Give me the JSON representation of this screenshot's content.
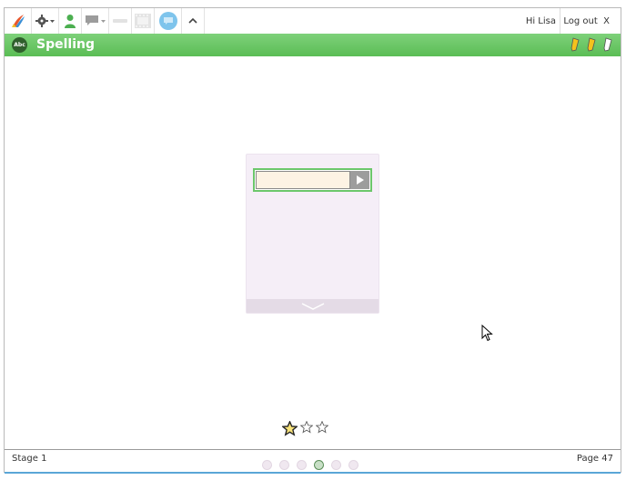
{
  "toolbar": {
    "greeting": "Hi Lisa",
    "logout_label": "Log out",
    "close_label": "X"
  },
  "titlebar": {
    "icon_text": "Abc",
    "title": "Spelling"
  },
  "panel": {
    "input_value": ""
  },
  "stars": {
    "filled": 1,
    "total": 3
  },
  "footer": {
    "stage": "Stage 1",
    "page": "Page 47",
    "dot_count": 6,
    "active_dot": 4
  },
  "colors": {
    "accent_green": "#5bbd55",
    "panel_bg": "#f5eef7"
  }
}
